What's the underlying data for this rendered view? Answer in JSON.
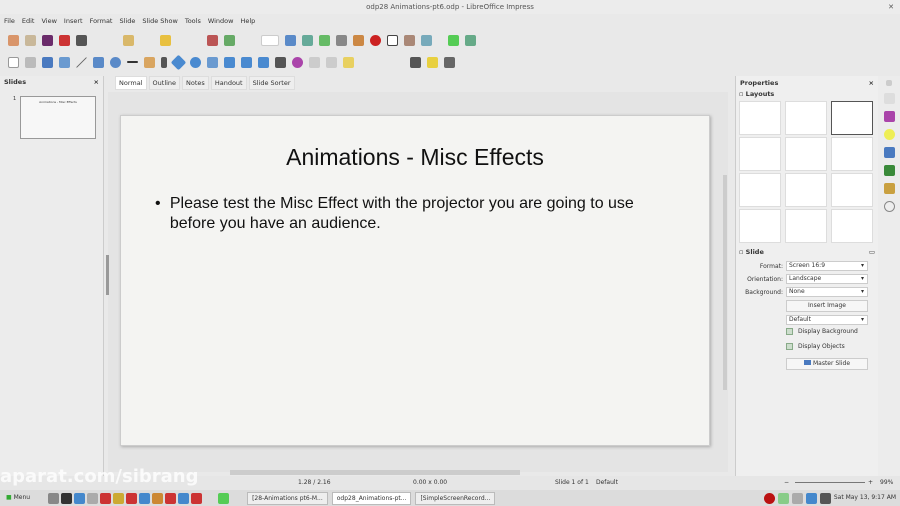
{
  "window": {
    "title": "odp28 Animations-pt6.odp - LibreOffice Impress"
  },
  "menu": [
    "File",
    "Edit",
    "View",
    "Insert",
    "Format",
    "Slide",
    "Slide Show",
    "Tools",
    "Window",
    "Help"
  ],
  "slides_panel": {
    "title": "Slides",
    "close": "×",
    "thumb_number": "1",
    "thumb_title": "Animations - Misc Effects"
  },
  "view_tabs": [
    "Normal",
    "Outline",
    "Notes",
    "Handout",
    "Slide Sorter"
  ],
  "slide": {
    "title": "Animations - Misc Effects",
    "bullet": "•",
    "body": "Please test the Misc Effect with the projector you are going to use before you have an audience."
  },
  "properties": {
    "title": "Properties",
    "close": "×",
    "layouts_label": "Layouts",
    "slide_label": "Slide",
    "format_label": "Format:",
    "format_value": "Screen 16:9",
    "orientation_label": "Orientation:",
    "orientation_value": "Landscape",
    "background_label": "Background:",
    "background_value": "None",
    "insert_image": "Insert Image",
    "master_value": "Default",
    "display_background": "Display Background",
    "display_objects": "Display Objects",
    "master_slide": "Master Slide"
  },
  "status": {
    "position": "1.28 / 2.16",
    "size": "0.00 x 0.00",
    "slide": "Slide 1 of 1",
    "master": "Default",
    "zoom": "99%"
  },
  "taskbar": {
    "menu": "Menu",
    "tasks": [
      "[28-Animations pt6-M...",
      "odp28_Animations-pt...",
      "[SimpleScreenRecord..."
    ],
    "clock": "Sat May 13, 9:17 AM"
  },
  "watermark": "aparat.com/sibrang"
}
